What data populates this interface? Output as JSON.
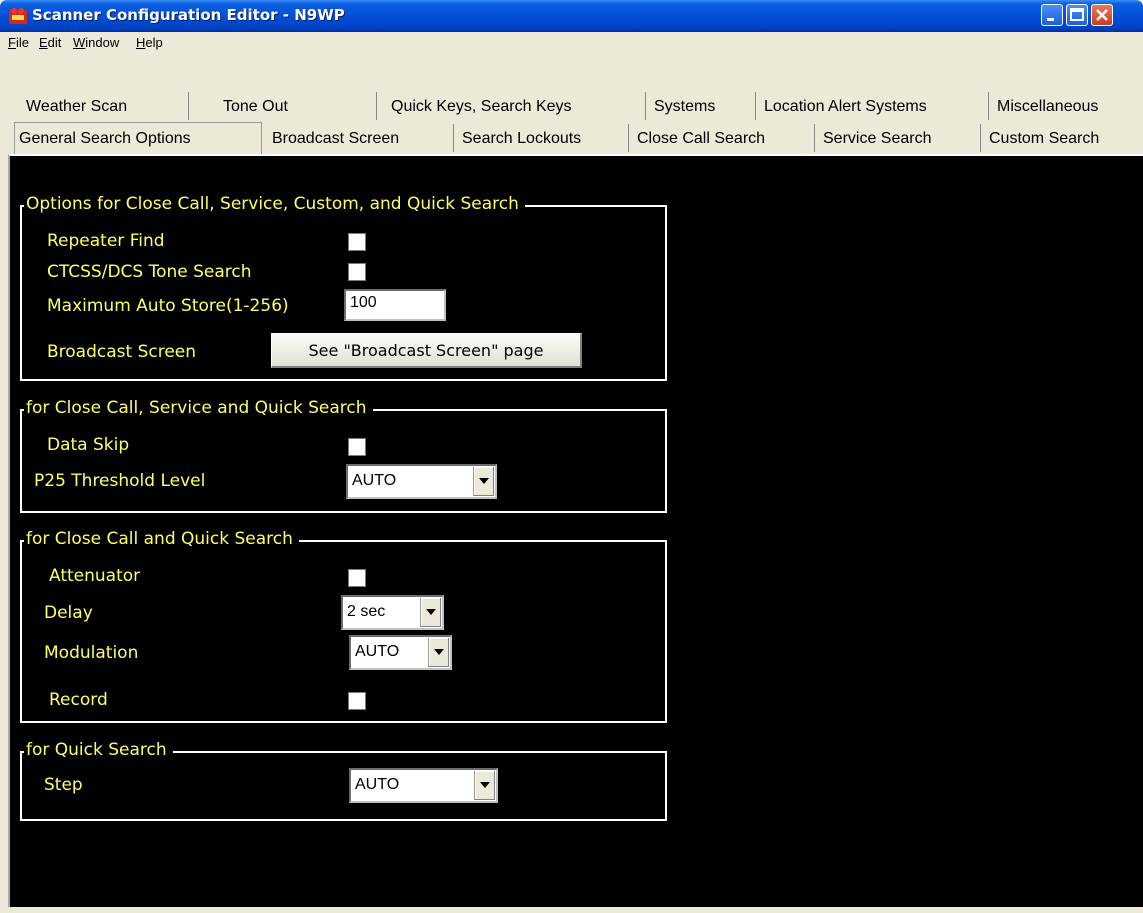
{
  "window": {
    "title": "Scanner Configuration Editor - N9WP"
  },
  "menu": [
    "File",
    "Edit",
    "Window",
    "Help"
  ],
  "tabs": {
    "row1": [
      "Weather Scan",
      "Tone Out",
      "Quick Keys, Search Keys",
      "Systems",
      "Location Alert Systems",
      "Miscellaneous"
    ],
    "row2": [
      "General Search Options",
      "Broadcast Screen",
      "Search Lockouts",
      "Close Call Search",
      "Service Search",
      "Custom Search"
    ],
    "active": "General Search Options"
  },
  "groups": {
    "g1": {
      "title": "Options for Close Call, Service, Custom, and Quick Search",
      "repeater_find": "Repeater Find",
      "tone_search": "CTCSS/DCS Tone Search",
      "max_auto_store": "Maximum Auto Store(1-256)",
      "max_auto_store_value": "100",
      "broadcast_screen": "Broadcast Screen",
      "broadcast_button": "See \"Broadcast Screen\" page"
    },
    "g2": {
      "title": "for Close Call, Service and Quick Search",
      "data_skip": "Data Skip",
      "p25_threshold": "P25 Threshold Level",
      "p25_value": "AUTO"
    },
    "g3": {
      "title": "for Close Call and Quick Search",
      "attenuator": "Attenuator",
      "delay": "Delay",
      "delay_value": "2 sec",
      "modulation": "Modulation",
      "modulation_value": "AUTO",
      "record": "Record"
    },
    "g4": {
      "title": "for Quick Search",
      "step": "Step",
      "step_value": "AUTO"
    }
  },
  "checkboxes": {
    "repeater_find": false,
    "tone_search": false,
    "data_skip": false,
    "attenuator": false,
    "record": false
  },
  "colors": {
    "label_text": "#ffff66",
    "panel_bg": "#000000",
    "titlebar": "#0450d8"
  }
}
